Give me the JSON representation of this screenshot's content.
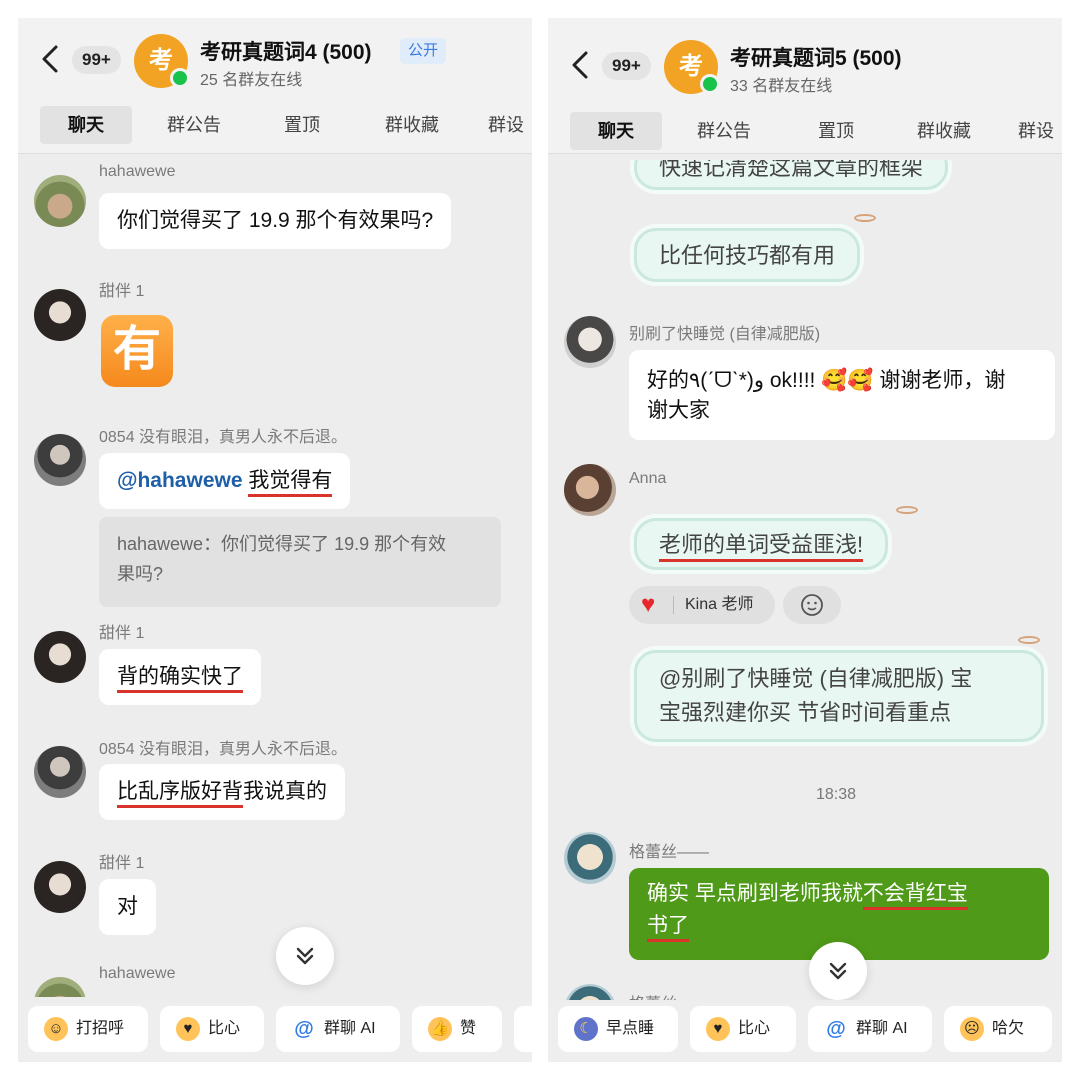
{
  "left": {
    "header": {
      "badge": "99+",
      "avatar_char": "考",
      "title": "考研真题词4 (500)",
      "subtitle": "25 名群友在线",
      "public_tag": "公开"
    },
    "tabs": [
      "聊天",
      "群公告",
      "置顶",
      "群收藏",
      "群设"
    ],
    "messages": {
      "m1": {
        "sender": "hahawewe",
        "text": "你们觉得买了 19.9 那个有效果吗?"
      },
      "m2": {
        "sender": "甜伴 1",
        "emoji": "有"
      },
      "m3": {
        "sender": "0854 没有眼泪，真男人永不后退。",
        "mention": "@hahawewe",
        "text": "我觉得有",
        "quote_line1": "hahawewe：你们觉得买了 19.9 那个有效",
        "quote_line2": "果吗?"
      },
      "m4": {
        "sender": "甜伴 1",
        "text": "背的确实快了"
      },
      "m5": {
        "sender": "0854 没有眼泪，真男人永不后退。",
        "text_underlined": "比乱序版好背",
        "text_rest": "我说真的"
      },
      "m6": {
        "sender": "甜伴 1",
        "text": "对"
      },
      "m7": {
        "sender": "hahawewe"
      }
    },
    "quick_replies": [
      "打招呼",
      "比心",
      "群聊 AI",
      "赞"
    ]
  },
  "right": {
    "header": {
      "badge": "99+",
      "avatar_char": "考",
      "title": "考研真题词5 (500)",
      "subtitle": "33 名群友在线"
    },
    "tabs": [
      "聊天",
      "群公告",
      "置顶",
      "群收藏",
      "群设"
    ],
    "messages": {
      "r0": {
        "text": "快速记清楚这篇文章的框架"
      },
      "r1": {
        "text": "比任何技巧都有用"
      },
      "r2": {
        "sender": "别刷了快睡觉 (自律减肥版)",
        "line1": "好的٩(ˊᗜˋ*)و ok!!!! 🥰🥰 谢谢老师，谢",
        "line2": "谢大家"
      },
      "r3": {
        "sender": "Anna",
        "text": "老师的单词受益匪浅!"
      },
      "reaction": {
        "label": "Kina 老师"
      },
      "r4": {
        "line1": "@别刷了快睡觉 (自律减肥版) 宝",
        "line2": "宝强烈建你买 节省时间看重点"
      },
      "time": "18:38",
      "r5": {
        "sender": "格蕾丝——",
        "line1_plain": "确实 早点刷到老师我就",
        "line1_u": "不会背红宝",
        "line2_u": "书了"
      },
      "r6": {
        "sender": "格蕾丝——"
      }
    },
    "quick_replies": [
      "早点睡",
      "比心",
      "群聊 AI",
      "哈欠"
    ]
  },
  "colors": {
    "accent_green": "#4f9a18",
    "underline_red": "#d8342c",
    "avatar_orange": "#f2a323",
    "online_green": "#19c24b",
    "mention_blue": "#1f5fa8"
  },
  "icons": [
    "back-arrow-icon",
    "scroll-down-icon",
    "heart-icon",
    "emoji-add-icon",
    "wave-icon",
    "heart-hands-icon",
    "at-icon",
    "thumbs-up-icon",
    "moon-icon",
    "yawn-icon"
  ]
}
